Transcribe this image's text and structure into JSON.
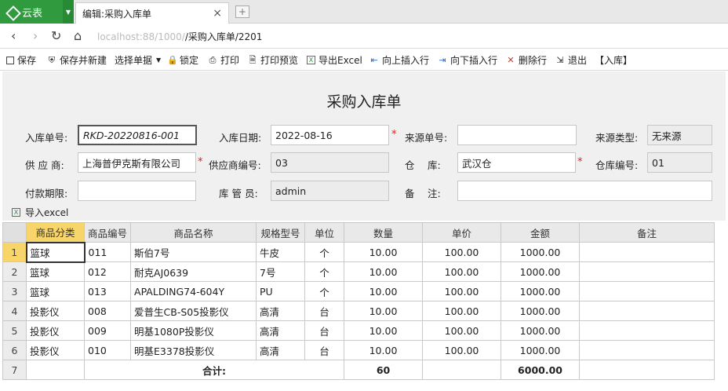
{
  "browser": {
    "app_name": "云表",
    "tab_title": "编辑:采购入库单",
    "url_host": "localhost:88/1000/",
    "url_path": "/采购入库单/2201"
  },
  "toolbar": {
    "items": [
      {
        "label": "保存",
        "icon": "save-icon"
      },
      {
        "label": "保存并新建",
        "icon": "shield-icon"
      },
      {
        "label": "选择单据",
        "icon": "dropdown-caret"
      },
      {
        "label": "锁定",
        "icon": "lock-icon"
      },
      {
        "label": "打印",
        "icon": "printer-icon"
      },
      {
        "label": "打印预览",
        "icon": "preview-icon"
      },
      {
        "label": "导出Excel",
        "icon": "excel-icon"
      },
      {
        "label": "向上插入行",
        "icon": "insert-up-icon"
      },
      {
        "label": "向下插入行",
        "icon": "insert-down-icon"
      },
      {
        "label": "删除行",
        "icon": "delete-row-icon"
      },
      {
        "label": "退出",
        "icon": "exit-icon"
      },
      {
        "label": "【入库】",
        "icon": ""
      }
    ]
  },
  "form": {
    "title": "采购入库单",
    "labels": {
      "order_no": "入库单号:",
      "date": "入库日期:",
      "source_no": "来源单号:",
      "source_type": "来源类型:",
      "supplier": "供 应 商:",
      "supplier_no": "供应商编号:",
      "warehouse": "仓　 库:",
      "warehouse_no": "仓库编号:",
      "payment_term": "付款期限:",
      "keeper": "库 管 员:",
      "remark": "备　 注:"
    },
    "values": {
      "order_no": "RKD-20220816-001",
      "date": "2022-08-16",
      "source_no": "",
      "source_type": "无来源",
      "supplier": "上海普伊克斯有限公司",
      "supplier_no": "03",
      "warehouse": "武汉仓",
      "warehouse_no": "01",
      "payment_term": "",
      "keeper": "admin",
      "remark": ""
    },
    "required_mark": "*",
    "import_label": "导入excel"
  },
  "grid": {
    "headers": [
      "商品分类",
      "商品编号",
      "商品名称",
      "规格型号",
      "单位",
      "数量",
      "单价",
      "金额",
      "备注"
    ],
    "rows": [
      {
        "rn": "1",
        "cat": "篮球",
        "code": "011",
        "name": "斯伯7号",
        "spec": "牛皮",
        "unit": "个",
        "qty": "10.00",
        "price": "100.00",
        "amount": "1000.00",
        "note": ""
      },
      {
        "rn": "2",
        "cat": "篮球",
        "code": "012",
        "name": "耐克AJ0639",
        "spec": "7号",
        "unit": "个",
        "qty": "10.00",
        "price": "100.00",
        "amount": "1000.00",
        "note": ""
      },
      {
        "rn": "3",
        "cat": "篮球",
        "code": "013",
        "name": "APALDING74-604Y",
        "spec": "PU",
        "unit": "个",
        "qty": "10.00",
        "price": "100.00",
        "amount": "1000.00",
        "note": ""
      },
      {
        "rn": "4",
        "cat": "投影仪",
        "code": "008",
        "name": "爱普生CB-S05投影仪",
        "spec": "高清",
        "unit": "台",
        "qty": "10.00",
        "price": "100.00",
        "amount": "1000.00",
        "note": ""
      },
      {
        "rn": "5",
        "cat": "投影仪",
        "code": "009",
        "name": "明基1080P投影仪",
        "spec": "高清",
        "unit": "台",
        "qty": "10.00",
        "price": "100.00",
        "amount": "1000.00",
        "note": ""
      },
      {
        "rn": "6",
        "cat": "投影仪",
        "code": "010",
        "name": "明基E3378投影仪",
        "spec": "高清",
        "unit": "台",
        "qty": "10.00",
        "price": "100.00",
        "amount": "1000.00",
        "note": ""
      }
    ],
    "total_row": {
      "rn": "7",
      "label": "合计:",
      "qty": "60",
      "amount": "6000.00"
    }
  }
}
